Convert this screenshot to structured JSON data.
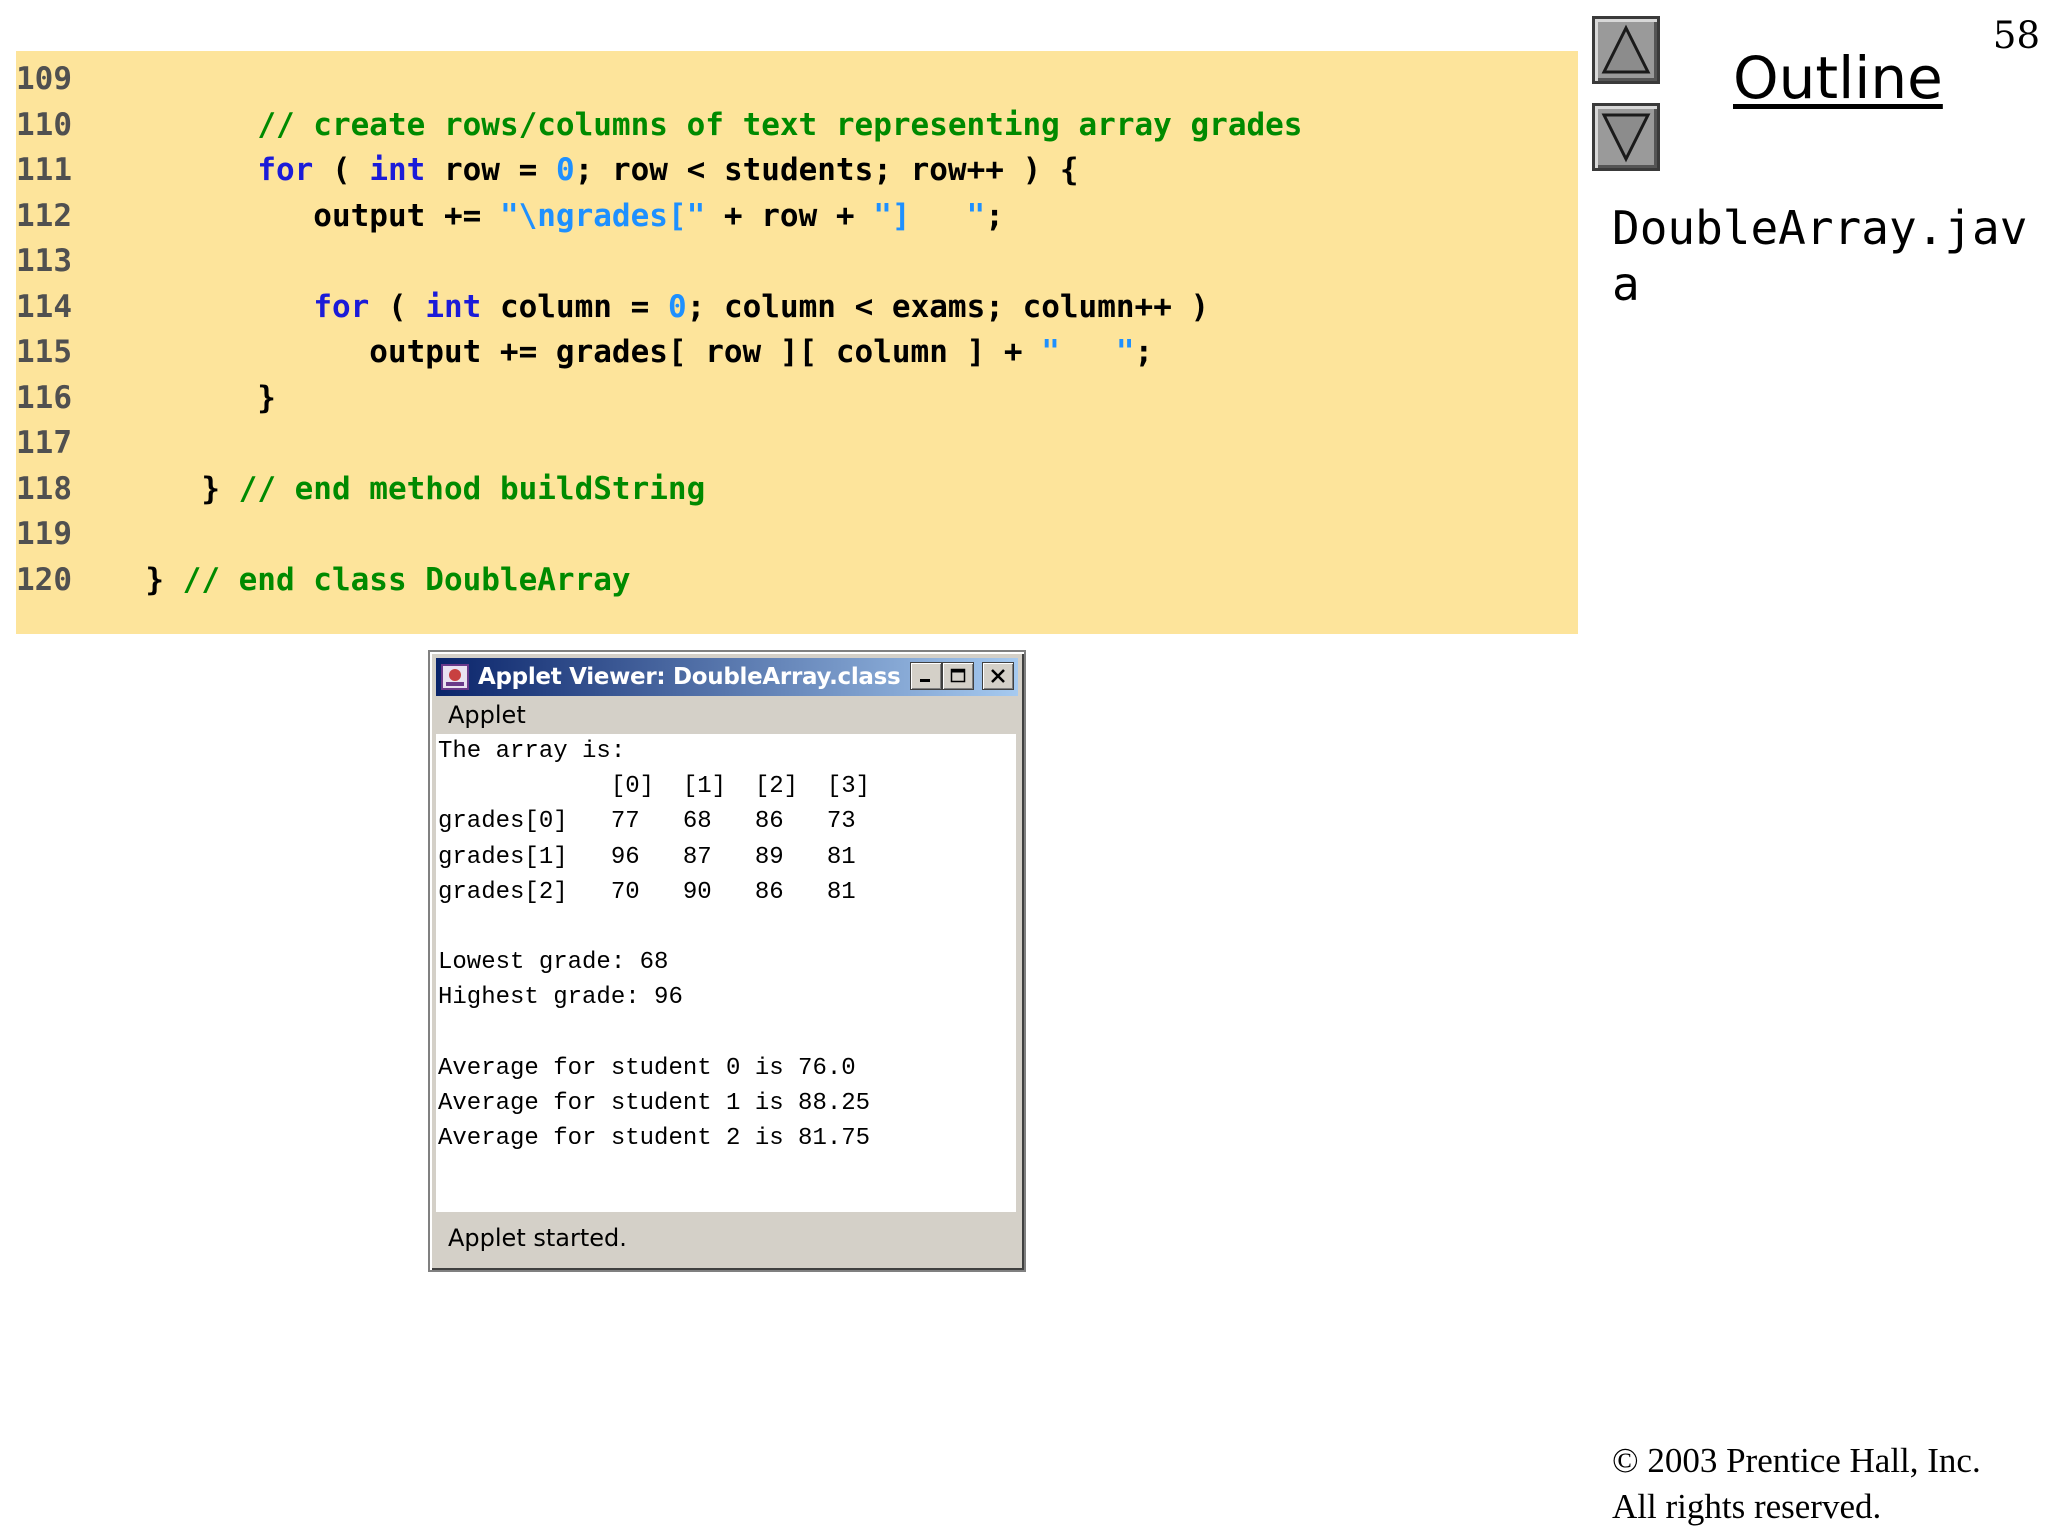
{
  "page_number": "58",
  "outline": {
    "title": "Outline",
    "file_name": "DoubleArray.java"
  },
  "copyright": {
    "line1": "© 2003 Prentice Hall, Inc.",
    "line2": "All rights reserved."
  },
  "colors": {
    "code_background": "#fde49b",
    "keyword": "#1b1bd8",
    "comment": "#008a00",
    "string": "#1e90ff"
  },
  "code": {
    "lines": [
      {
        "num": "109",
        "parts": []
      },
      {
        "num": "110",
        "parts": [
          {
            "t": "        ",
            "c": "tx"
          },
          {
            "t": "// create rows/columns of text representing array grades",
            "c": "cm"
          }
        ]
      },
      {
        "num": "111",
        "parts": [
          {
            "t": "        ",
            "c": "tx"
          },
          {
            "t": "for",
            "c": "kw"
          },
          {
            "t": " ( ",
            "c": "tx"
          },
          {
            "t": "int",
            "c": "kw"
          },
          {
            "t": " row = ",
            "c": "tx"
          },
          {
            "t": "0",
            "c": "nm"
          },
          {
            "t": "; row < students; row++ ) {",
            "c": "tx"
          }
        ]
      },
      {
        "num": "112",
        "parts": [
          {
            "t": "           output += ",
            "c": "tx"
          },
          {
            "t": "\"\\ngrades[\"",
            "c": "st"
          },
          {
            "t": " + row + ",
            "c": "tx"
          },
          {
            "t": "\"]   \"",
            "c": "st"
          },
          {
            "t": ";",
            "c": "tx"
          }
        ]
      },
      {
        "num": "113",
        "parts": []
      },
      {
        "num": "114",
        "parts": [
          {
            "t": "           ",
            "c": "tx"
          },
          {
            "t": "for",
            "c": "kw"
          },
          {
            "t": " ( ",
            "c": "tx"
          },
          {
            "t": "int",
            "c": "kw"
          },
          {
            "t": " column = ",
            "c": "tx"
          },
          {
            "t": "0",
            "c": "nm"
          },
          {
            "t": "; column < exams; column++ )",
            "c": "tx"
          }
        ]
      },
      {
        "num": "115",
        "parts": [
          {
            "t": "              output += grades[ row ][ column ] + ",
            "c": "tx"
          },
          {
            "t": "\"   \"",
            "c": "st"
          },
          {
            "t": ";",
            "c": "tx"
          }
        ]
      },
      {
        "num": "116",
        "parts": [
          {
            "t": "        }",
            "c": "tx"
          }
        ]
      },
      {
        "num": "117",
        "parts": []
      },
      {
        "num": "118",
        "parts": [
          {
            "t": "     } ",
            "c": "tx"
          },
          {
            "t": "// end method buildString",
            "c": "cm"
          }
        ]
      },
      {
        "num": "119",
        "parts": []
      },
      {
        "num": "120",
        "parts": [
          {
            "t": "  } ",
            "c": "tx"
          },
          {
            "t": "// end class DoubleArray",
            "c": "cm"
          }
        ]
      }
    ]
  },
  "applet": {
    "title": "Applet Viewer: DoubleArray.class",
    "menu_label": "Applet",
    "status": "Applet started.",
    "output_lines": [
      "The array is:",
      "            [0]  [1]  [2]  [3]",
      "grades[0]   77   68   86   73",
      "grades[1]   96   87   89   81",
      "grades[2]   70   90   86   81",
      "",
      "Lowest grade: 68",
      "Highest grade: 96",
      "",
      "Average for student 0 is 76.0",
      "Average for student 1 is 88.25",
      "Average for student 2 is 81.75"
    ]
  }
}
